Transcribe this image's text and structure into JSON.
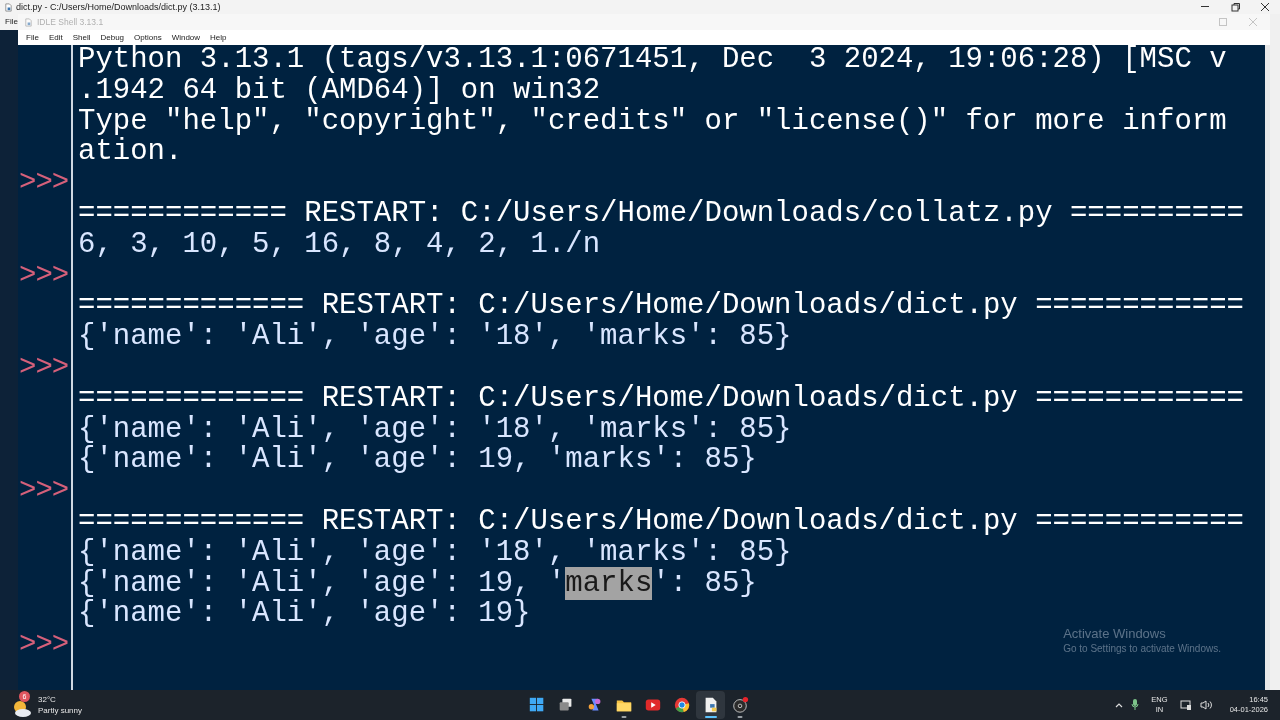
{
  "background_window": {
    "title": "dict.py - C:/Users/Home/Downloads/dict.py (3.13.1)",
    "menu": [
      "File"
    ]
  },
  "shell_window": {
    "title": "IDLE Shell 3.13.1",
    "menu": [
      "File",
      "Edit",
      "Shell",
      "Debug",
      "Options",
      "Window",
      "Help"
    ],
    "lines": [
      {
        "kind": "banner",
        "text": "Python 3.13.1 (tags/v3.13.1:0671451, Dec  3 2024, 19:06:28) [MSC v"
      },
      {
        "kind": "banner",
        "text": ".1942 64 bit (AMD64)] on win32"
      },
      {
        "kind": "banner",
        "text": "Type \"help\", \"copyright\", \"credits\" or \"license()\" for more inform"
      },
      {
        "kind": "banner",
        "text": "ation."
      },
      {
        "kind": "prompt",
        "prompt": ">>>"
      },
      {
        "kind": "restart",
        "text": "============ RESTART: C:/Users/Home/Downloads/collatz.py =========="
      },
      {
        "kind": "output",
        "text": "6, 3, 10, 5, 16, 8, 4, 2, 1./n"
      },
      {
        "kind": "prompt",
        "prompt": ">>>"
      },
      {
        "kind": "restart",
        "text": "============= RESTART: C:/Users/Home/Downloads/dict.py ============"
      },
      {
        "kind": "output",
        "text": "{'name': 'Ali', 'age': '18', 'marks': 85}"
      },
      {
        "kind": "prompt",
        "prompt": ">>>"
      },
      {
        "kind": "restart",
        "text": "============= RESTART: C:/Users/Home/Downloads/dict.py ============"
      },
      {
        "kind": "output",
        "text": "{'name': 'Ali', 'age': '18', 'marks': 85}"
      },
      {
        "kind": "output",
        "text": "{'name': 'Ali', 'age': 19, 'marks': 85}"
      },
      {
        "kind": "prompt",
        "prompt": ">>>"
      },
      {
        "kind": "restart",
        "text": "============= RESTART: C:/Users/Home/Downloads/dict.py ============"
      },
      {
        "kind": "output",
        "text": "{'name': 'Ali', 'age': '18', 'marks': 85}"
      },
      {
        "kind": "output",
        "segments": [
          {
            "text": "{'name': 'Ali', 'age': 19, '",
            "selected": false
          },
          {
            "text": "marks",
            "selected": true
          },
          {
            "text": "': 85}",
            "selected": false
          }
        ]
      },
      {
        "kind": "output",
        "text": "{'name': 'Ali', 'age': 19}"
      },
      {
        "kind": "prompt",
        "prompt": ">>>"
      }
    ]
  },
  "activation_notice": {
    "title": "Activate Windows",
    "subtitle": "Go to Settings to activate Windows."
  },
  "taskbar": {
    "weather": {
      "badge": "6",
      "temperature": "32°C",
      "condition": "Partly sunny"
    },
    "apps": [
      {
        "kind": "start",
        "running": false,
        "active": false
      },
      {
        "kind": "task-view",
        "running": false,
        "active": false
      },
      {
        "kind": "copilot",
        "running": false,
        "active": false
      },
      {
        "kind": "files",
        "running": true,
        "active": false
      },
      {
        "kind": "video",
        "running": false,
        "active": false
      },
      {
        "kind": "browser",
        "running": false,
        "active": false
      },
      {
        "kind": "python",
        "running": true,
        "active": true
      },
      {
        "kind": "recorder",
        "running": true,
        "active": false
      }
    ],
    "tray": {
      "language": "ENG",
      "region": "IN",
      "time": "16:45",
      "date": "04-01-2026"
    }
  }
}
